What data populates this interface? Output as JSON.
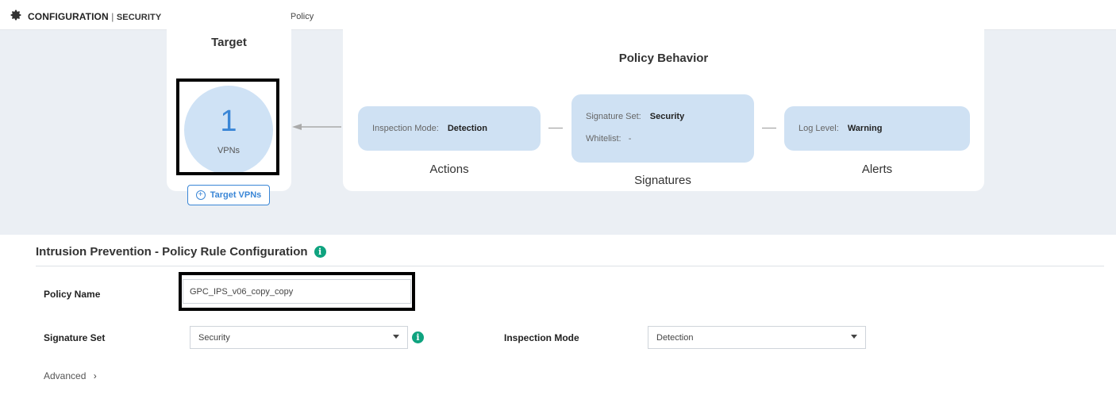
{
  "header": {
    "section": "CONFIGURATION",
    "separator": "|",
    "subsection": "SECURITY",
    "page_title": "Edit Intrusion Prevention Policy",
    "icon": "gear-icon"
  },
  "target": {
    "title": "Target",
    "vpn_count": "1",
    "vpn_label": "VPNs",
    "button_label": "Target VPNs"
  },
  "policy_behavior": {
    "title": "Policy Behavior",
    "actions": {
      "inspection_mode_label": "Inspection Mode:",
      "inspection_mode_value": "Detection",
      "group_label": "Actions"
    },
    "signatures": {
      "signature_set_label": "Signature Set:",
      "signature_set_value": "Security",
      "whitelist_label": "Whitelist:",
      "whitelist_value": "-",
      "group_label": "Signatures"
    },
    "alerts": {
      "log_level_label": "Log Level:",
      "log_level_value": "Warning",
      "group_label": "Alerts"
    }
  },
  "rule_config": {
    "title": "Intrusion Prevention - Policy Rule Configuration",
    "policy_name_label": "Policy Name",
    "policy_name_value": "GPC_IPS_v06_copy_copy",
    "signature_set_label": "Signature Set",
    "signature_set_value": "Security",
    "inspection_mode_label": "Inspection Mode",
    "inspection_mode_value": "Detection",
    "advanced_label": "Advanced"
  },
  "colors": {
    "accent": "#3a86d6",
    "pill_bg": "#cfe1f3",
    "canvas_bg": "#ebeff4",
    "info_green": "#0fa37f"
  }
}
